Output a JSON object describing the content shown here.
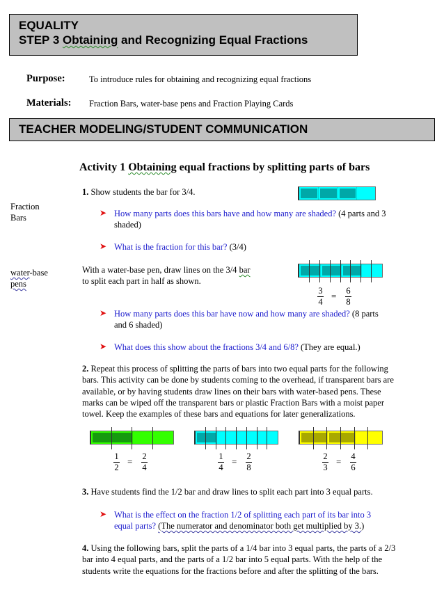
{
  "header": {
    "line1": "EQUALITY",
    "line2_prefix": "STEP 3 ",
    "line2_squiggle": "Obtaining",
    "line2_rest": " and Recognizing Equal Fractions"
  },
  "purpose": {
    "label": "Purpose:",
    "text": "To introduce rules for obtaining and recognizing equal fractions"
  },
  "materials": {
    "label": "Materials:",
    "text": "Fraction Bars, water-base  pens and Fraction Playing Cards"
  },
  "section_title": "TEACHER MODELING/STUDENT COMMUNICATION",
  "activity": {
    "prefix": "Activity 1 ",
    "squiggle": "Obtaining",
    "rest": " equal fractions by splitting parts of bars"
  },
  "side_notes": {
    "fraction_bars_1": "Fraction",
    "fraction_bars_2": "Bars",
    "pens_1a": "water",
    "pens_1b": "-base",
    "pens_2": "pens"
  },
  "step1": {
    "num": "1.",
    "text": " Show students the bar for 3/4.",
    "q1_blue": "How many parts does this bars have and how many are shaded?",
    "q1_answer_a": " (4 parts and 3",
    "q1_answer_b": "shaded)",
    "q2_blue": "What is the fraction for this bar?",
    "q2_answer": " (3/4)",
    "pen_text_1a": "With a water-base  pen, draw lines on the 3/4 ",
    "pen_text_1b": "bar",
    "pen_text_2": "to split each part in half as shown.",
    "q3_blue": "How many parts does this bar have now and how many are shaded?",
    "q3_answer_a": " (8 parts",
    "q3_answer_b": "and 6 shaded)",
    "q4_blue": "What does this show about the fractions 3/4 and 6/8?",
    "q4_answer": " (They are equal.)"
  },
  "step2": {
    "num": "2.",
    "lines": [
      " Repeat this process of splitting the parts of bars into two equal parts for the following",
      "bars. This activity can be done by students coming to the overhead, if transparent bars are",
      "available, or by having students draw lines on their bars with water-based  pens. These",
      "marks can be wiped off the transparent bars or plastic Fraction Bars with a moist paper",
      "towel. Keep the examples of these bars and equations for later generalizations."
    ]
  },
  "step3": {
    "num": "3.",
    "text": " Have students find the 1/2 bar and draw lines to split each part into 3 equal parts.",
    "q_blue_a": "What is the effect on the fraction 1/2 of splitting each part of its bar into 3",
    "q_blue_b": "equal parts?",
    "answer_squiggle": "(The numerator and denominator both get multiplied by 3.",
    "answer_end": ")"
  },
  "step4": {
    "num": "4.",
    "lines": [
      " Using the following bars, split the parts of a 1/4 bar into 3 equal parts, the parts of a 2/3",
      "bar into 4 equal parts, and the parts of a 1/2 bar into 5 equal parts. With the help of the",
      "students write the equations for the fractions before and after the splitting of the bars."
    ]
  },
  "bars": {
    "bar_3_4": {
      "parts": 4,
      "shaded": 3,
      "color": "#00ffff",
      "shade_color": "#009999"
    },
    "bar_3_4_split": {
      "parts": 4,
      "shaded": 3,
      "split_into": 2,
      "color": "#00ffff",
      "shade_color": "#009999"
    },
    "green": {
      "parts": 2,
      "shaded": 1,
      "split_into": 2,
      "color": "#33ff00",
      "shade_color": "#118811"
    },
    "cyan": {
      "parts": 4,
      "shaded": 1,
      "split_into": 2,
      "color": "#00ffff",
      "shade_color": "#009999"
    },
    "yellow": {
      "parts": 3,
      "shaded": 2,
      "split_into": 2,
      "color": "#ffff00",
      "shade_color": "#999900"
    }
  },
  "equations": {
    "eq1": {
      "a_num": "3",
      "a_den": "4",
      "eq": "=",
      "b_num": "6",
      "b_den": "8"
    },
    "eq_green": {
      "a_num": "1",
      "a_den": "2",
      "eq": "=",
      "b_num": "2",
      "b_den": "4"
    },
    "eq_cyan": {
      "a_num": "1",
      "a_den": "4",
      "eq": "=",
      "b_num": "2",
      "b_den": "8"
    },
    "eq_yellow": {
      "a_num": "2",
      "a_den": "3",
      "eq": "=",
      "b_num": "4",
      "b_den": "6"
    }
  },
  "colors": {
    "question_blue": "#1a1acc",
    "arrow_red": "#e01010",
    "header_gray": "#c0c0c0"
  }
}
